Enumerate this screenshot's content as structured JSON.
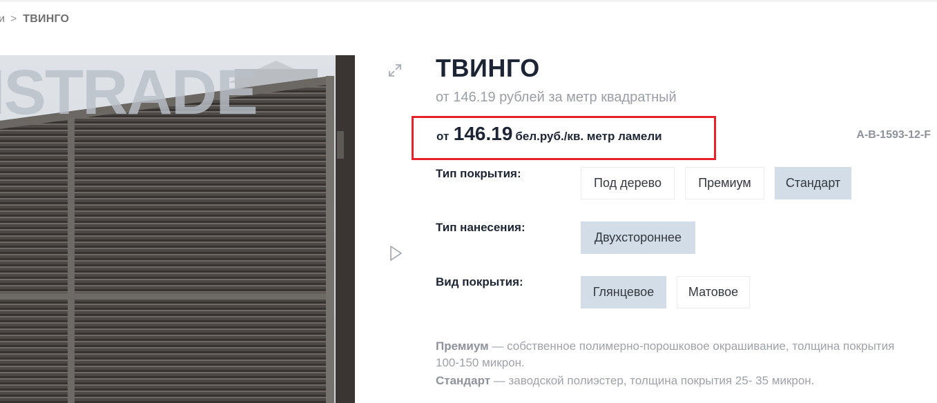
{
  "breadcrumb": {
    "prev": "и",
    "separator": ">",
    "current": "ТВИНГО"
  },
  "image": {
    "watermark": "ISTRADE"
  },
  "product": {
    "title": "ТВИНГО",
    "subtitle": "от 146.19 рублей за метр квадратный",
    "price_from": "от",
    "price_value": "146.19",
    "price_unit": "бел.руб./кв. метр ламели",
    "sku": "A-B-1593-12-F",
    "highlight_color": "#e8202a"
  },
  "options": {
    "coating_type": {
      "label": "Тип покрытия:",
      "values": [
        "Под дерево",
        "Премиум",
        "Стандарт"
      ],
      "selected": "Стандарт"
    },
    "application_type": {
      "label": "Тип нанесения:",
      "values": [
        "Двухстороннее"
      ],
      "selected": "Двухстороннее"
    },
    "finish_type": {
      "label": "Вид покрытия:",
      "values": [
        "Глянцевое",
        "Матовое"
      ],
      "selected": "Глянцевое"
    }
  },
  "description": {
    "premium_term": "Премиум",
    "premium_text": " — собственное полимерно-порошковое окрашивание, толщина покрытия 100-150 микрон.",
    "standard_term": "Стандарт",
    "standard_text": " — заводской полиэстер, толщина покрытия 25- 35 микрон."
  },
  "icons": {
    "expand": "expand-icon",
    "play": "play-icon"
  },
  "colors": {
    "selected_option_bg": "#d3dde7",
    "title": "#1d2433"
  }
}
